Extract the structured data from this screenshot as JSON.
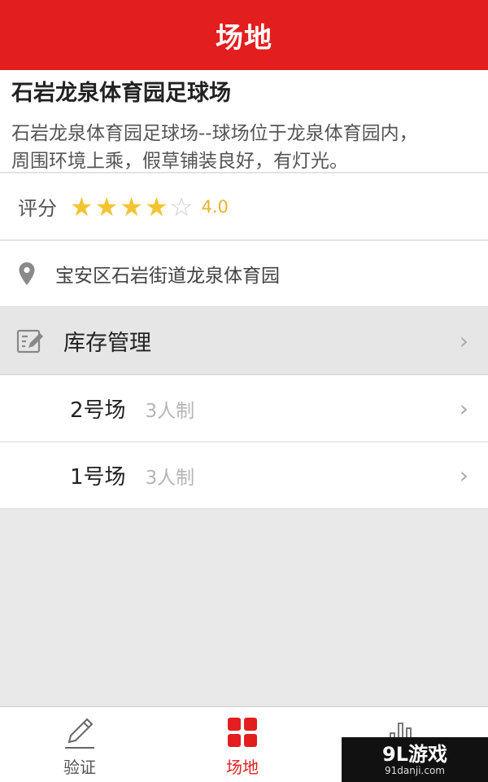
{
  "header": {
    "title": "场地"
  },
  "venue": {
    "name": "石岩龙泉体育园足球场",
    "description_line1": "石岩龙泉体育园足球场--球场位于龙泉体育园内，",
    "description_line2": "周围环境上乘，假草铺装良好，有灯光。"
  },
  "rating": {
    "label": "评分",
    "value": "4.0",
    "stars_filled": 4,
    "stars_total": 5,
    "star_glyph": "★",
    "star_empty_glyph": "☆"
  },
  "address": {
    "text": "宝安区石岩街道龙泉体育园",
    "icon": "location-pin-icon"
  },
  "inventory": {
    "label": "库存管理",
    "icon": "edit-icon",
    "chevron": "›"
  },
  "fields": [
    {
      "name": "2号场",
      "type": "3人制",
      "chevron": "›"
    },
    {
      "name": "1号场",
      "type": "3人制",
      "chevron": "›"
    }
  ],
  "bottom_nav": {
    "items": [
      {
        "label": "验证",
        "icon": "pencil-icon",
        "active": false
      },
      {
        "label": "场地",
        "icon": "grid-icon",
        "active": true
      },
      {
        "label": "",
        "icon": "bar-chart-icon",
        "active": false
      }
    ]
  },
  "watermark": {
    "brand": "9L游戏",
    "url": "91danji.com"
  },
  "colors": {
    "primary": "#e31e1e",
    "star": "#f2c431",
    "rating_text": "#e8b42a",
    "background": "#e9e9e9"
  }
}
